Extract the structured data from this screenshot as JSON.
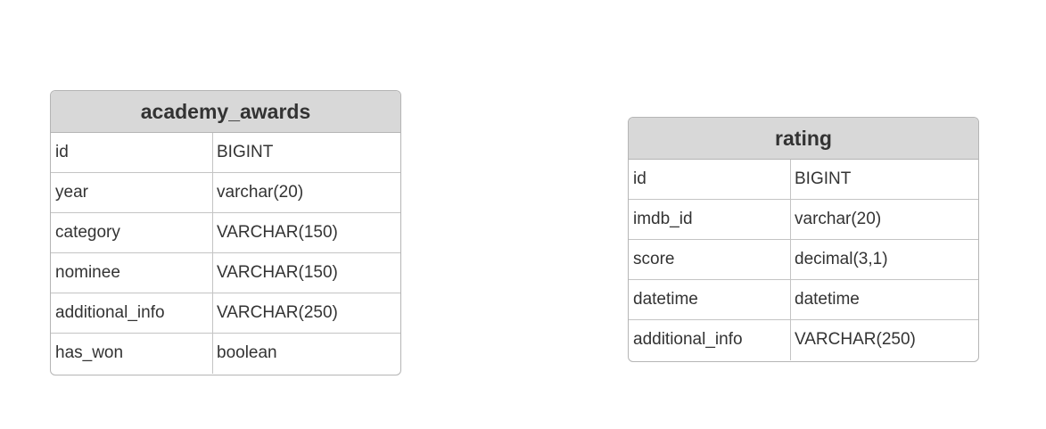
{
  "entities": [
    {
      "name": "academy_awards",
      "fields": [
        {
          "name": "id",
          "type": "BIGINT"
        },
        {
          "name": "year",
          "type": "varchar(20)"
        },
        {
          "name": "category",
          "type": "VARCHAR(150)"
        },
        {
          "name": "nominee",
          "type": "VARCHAR(150)"
        },
        {
          "name": "additional_info",
          "type": "VARCHAR(250)"
        },
        {
          "name": "has_won",
          "type": "boolean"
        }
      ]
    },
    {
      "name": "rating",
      "fields": [
        {
          "name": "id",
          "type": "BIGINT"
        },
        {
          "name": "imdb_id",
          "type": "varchar(20)"
        },
        {
          "name": "score",
          "type": "decimal(3,1)"
        },
        {
          "name": "datetime",
          "type": "datetime"
        },
        {
          "name": "additional_info",
          "type": "VARCHAR(250)"
        }
      ]
    }
  ]
}
